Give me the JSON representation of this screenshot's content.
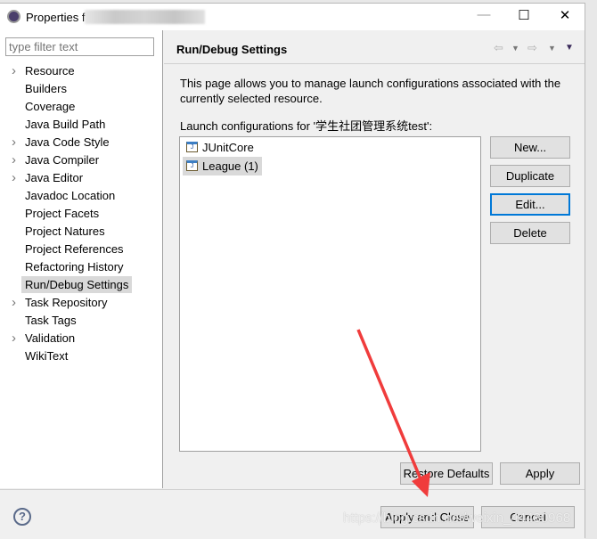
{
  "window": {
    "title": "Properties f",
    "title_blurred": true,
    "minimize": "—",
    "maximize": "☐",
    "close": "✕"
  },
  "sidebar": {
    "filter_placeholder": "type filter text",
    "items": [
      {
        "label": "Resource",
        "expandable": true
      },
      {
        "label": "Builders",
        "expandable": false
      },
      {
        "label": "Coverage",
        "expandable": false
      },
      {
        "label": "Java Build Path",
        "expandable": false
      },
      {
        "label": "Java Code Style",
        "expandable": true
      },
      {
        "label": "Java Compiler",
        "expandable": true
      },
      {
        "label": "Java Editor",
        "expandable": true
      },
      {
        "label": "Javadoc Location",
        "expandable": false
      },
      {
        "label": "Project Facets",
        "expandable": false
      },
      {
        "label": "Project Natures",
        "expandable": false
      },
      {
        "label": "Project References",
        "expandable": false
      },
      {
        "label": "Refactoring History",
        "expandable": false
      },
      {
        "label": "Run/Debug Settings",
        "expandable": false,
        "selected": true
      },
      {
        "label": "Task Repository",
        "expandable": true
      },
      {
        "label": "Task Tags",
        "expandable": false
      },
      {
        "label": "Validation",
        "expandable": true
      },
      {
        "label": "WikiText",
        "expandable": false
      }
    ]
  },
  "page": {
    "title": "Run/Debug Settings",
    "description": "This page allows you to manage launch configurations associated with the currently selected resource.",
    "list_label": "Launch configurations for '学生社团管理系统test':",
    "configs": [
      {
        "label": "JUnitCore",
        "icon": "junit-launch-icon"
      },
      {
        "label": "League (1)",
        "icon": "junit-launch-icon",
        "selected": true
      }
    ],
    "buttons": {
      "new": "New...",
      "duplicate": "Duplicate",
      "edit": "Edit...",
      "delete": "Delete"
    },
    "restore_defaults": "Restore Defaults",
    "apply": "Apply"
  },
  "footer": {
    "apply_close": "Apply and Close",
    "cancel": "Cancel"
  },
  "watermark": "https://blog.csdn.net/weixin_44480968",
  "colors": {
    "focus": "#0078d7",
    "annotation_arrow": "#f03c3c"
  }
}
